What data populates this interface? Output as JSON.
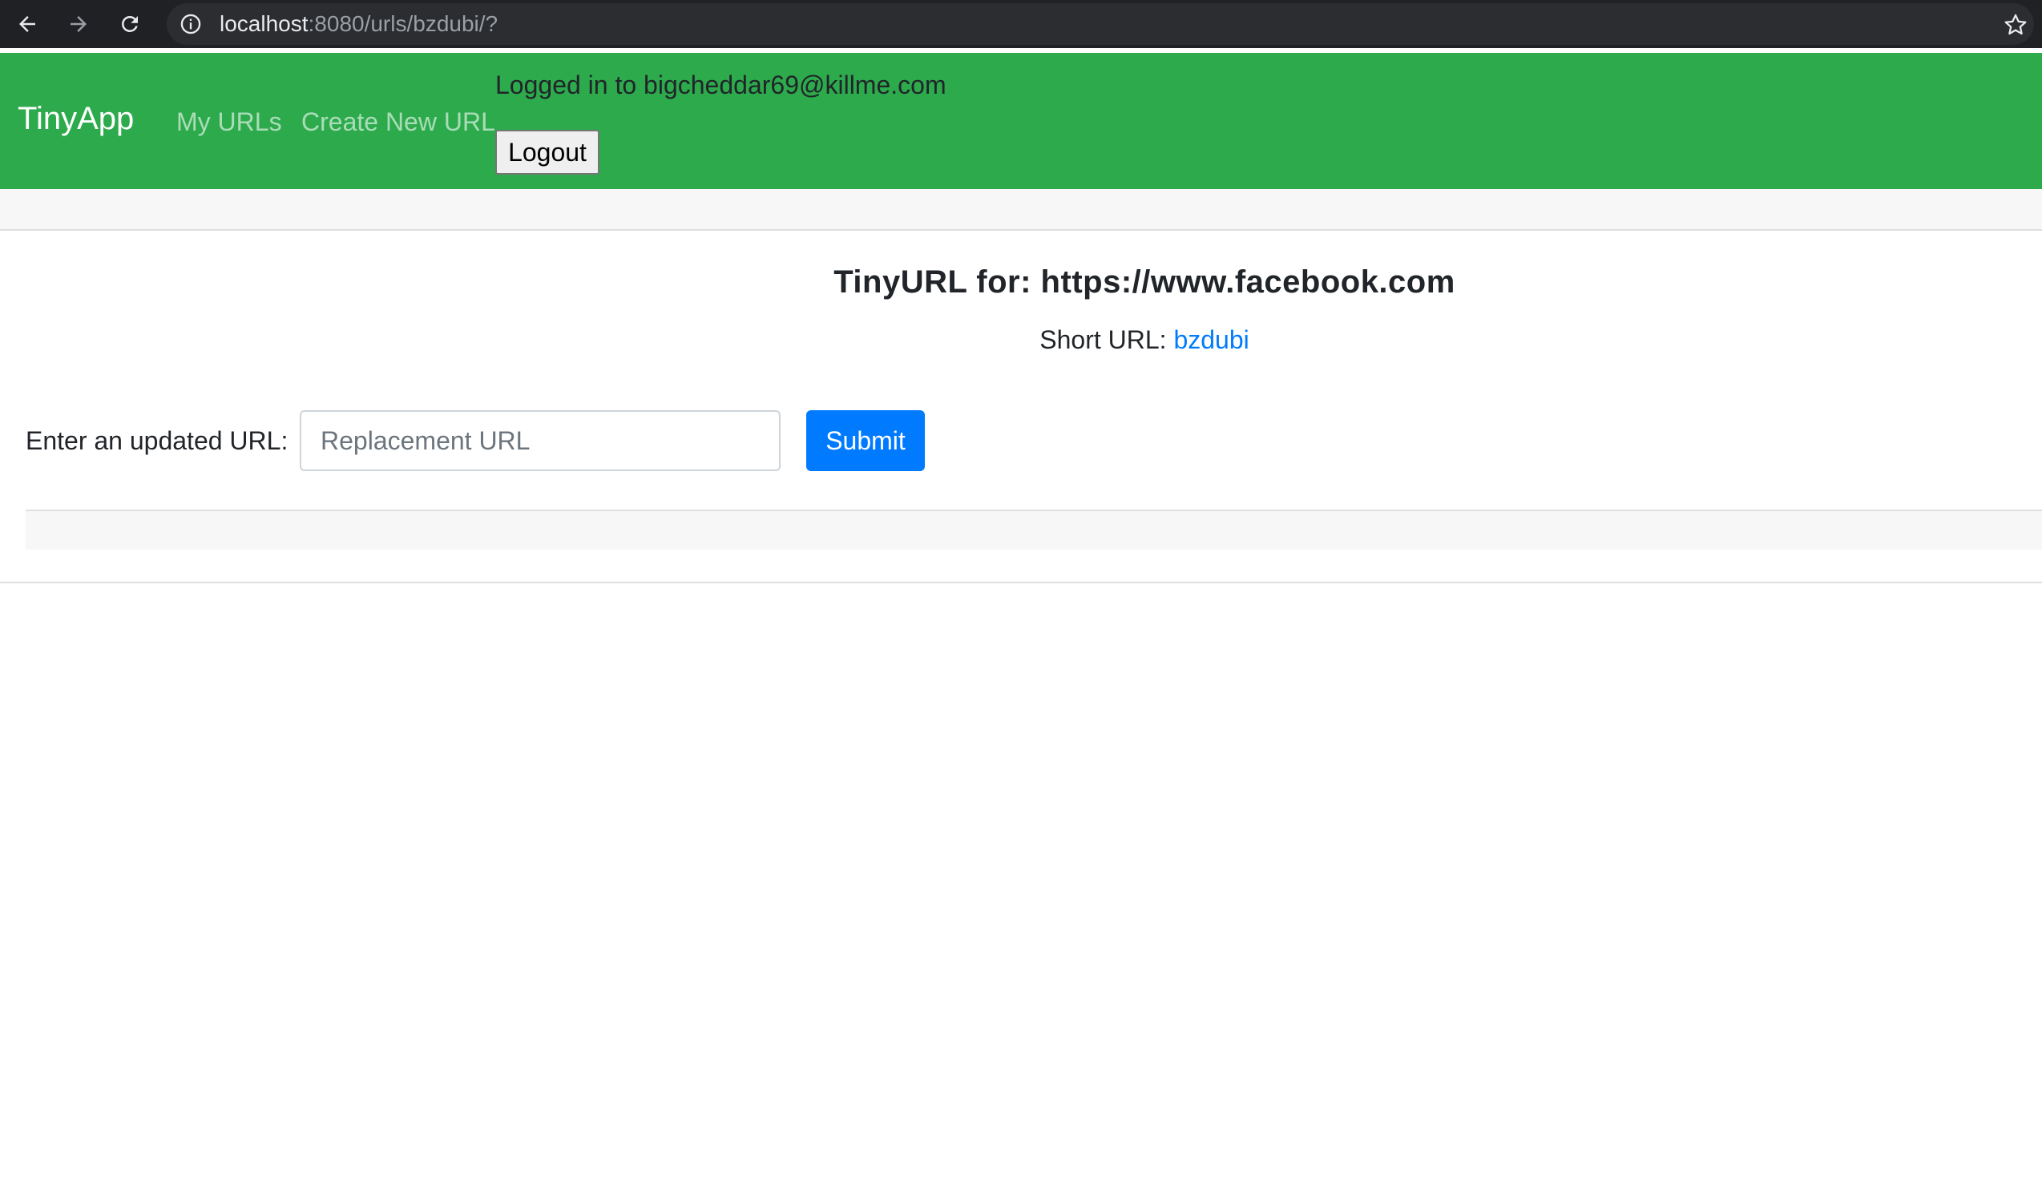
{
  "browser": {
    "url_host": "localhost",
    "url_rest": ":8080/urls/bzdubi/?"
  },
  "navbar": {
    "brand": "TinyApp",
    "links": [
      "My URLs",
      "Create New URL"
    ],
    "login_text": "Logged in to bigcheddar69@killme.com",
    "logout_label": "Logout"
  },
  "main": {
    "title": "TinyURL for: https://www.facebook.com",
    "short_url_label": "Short URL:",
    "short_url_value": "bzdubi",
    "form": {
      "label": "Enter an updated URL:",
      "input_placeholder": "Replacement URL",
      "input_value": "",
      "submit_label": "Submit"
    }
  },
  "colors": {
    "navbar_bg": "#2caa4c",
    "link_blue": "#007bff",
    "button_blue": "#007bff"
  }
}
